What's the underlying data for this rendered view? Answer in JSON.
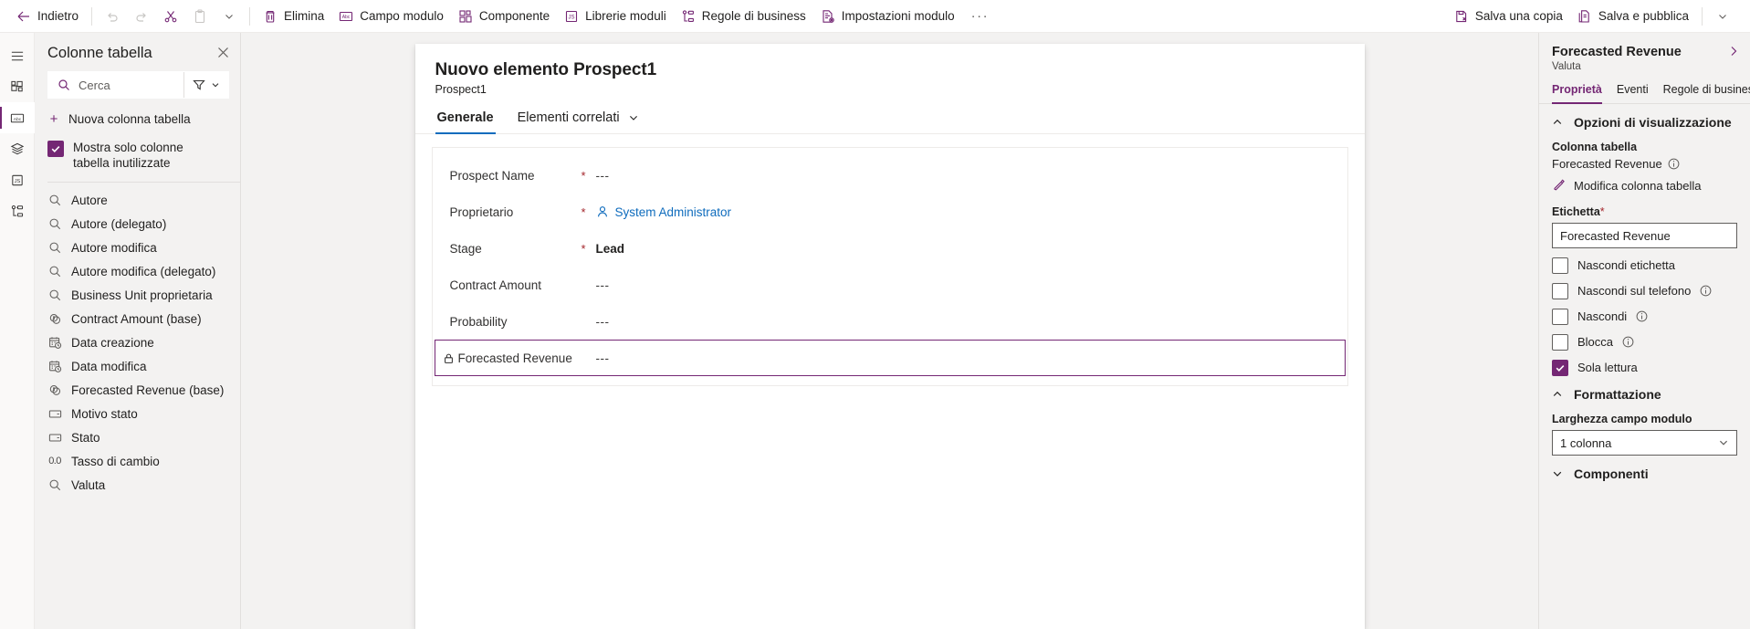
{
  "commandbar": {
    "back_label": "Indietro",
    "undo_label": "Annulla",
    "redo_label": "Ripeti",
    "cut_label": "Taglia",
    "paste_label": "Incolla",
    "delete_label": "Elimina",
    "form_field_label": "Campo modulo",
    "component_label": "Componente",
    "module_libraries_label": "Librerie moduli",
    "business_rules_label": "Regole di business",
    "form_settings_label": "Impostazioni modulo",
    "overflow_label": "···",
    "save_copy_label": "Salva una copia",
    "save_publish_label": "Salva e pubblica"
  },
  "rail": {
    "items": [
      {
        "name": "hamburger-menu",
        "label": "Menu"
      },
      {
        "name": "components",
        "label": "Componenti"
      },
      {
        "name": "table-columns",
        "label": "Colonne tabella"
      },
      {
        "name": "layers",
        "label": "Livelli"
      },
      {
        "name": "scripts",
        "label": "Librerie"
      },
      {
        "name": "business-rules",
        "label": "Regole di business"
      }
    ]
  },
  "columns_panel": {
    "title": "Colonne tabella",
    "search_placeholder": "Cerca",
    "filter_label": "Filtro",
    "new_column_label": "Nuova colonna tabella",
    "show_unused_label": "Mostra solo colonne tabella inutilizzate",
    "show_unused_checked": true,
    "items": [
      {
        "label": "Autore",
        "icon": "lookup-icon"
      },
      {
        "label": "Autore (delegato)",
        "icon": "lookup-icon"
      },
      {
        "label": "Autore modifica",
        "icon": "lookup-icon"
      },
      {
        "label": "Autore modifica (delegato)",
        "icon": "lookup-icon"
      },
      {
        "label": "Business Unit proprietaria",
        "icon": "lookup-icon"
      },
      {
        "label": "Contract Amount (base)",
        "icon": "currency-icon"
      },
      {
        "label": "Data creazione",
        "icon": "datetime-icon"
      },
      {
        "label": "Data modifica",
        "icon": "datetime-icon"
      },
      {
        "label": "Forecasted Revenue (base)",
        "icon": "currency-icon"
      },
      {
        "label": "Motivo stato",
        "icon": "choice-icon"
      },
      {
        "label": "Stato",
        "icon": "choice-icon"
      },
      {
        "label": "Tasso di cambio",
        "icon": "decimal-icon"
      },
      {
        "label": "Valuta",
        "icon": "lookup-icon"
      }
    ]
  },
  "form": {
    "title": "Nuovo elemento Prospect1",
    "subtitle": "Prospect1",
    "tabs": [
      {
        "label": "Generale",
        "active": true,
        "has_caret": false
      },
      {
        "label": "Elementi correlati",
        "active": false,
        "has_caret": true
      }
    ],
    "fields": [
      {
        "label": "Prospect Name",
        "required": true,
        "value": "---",
        "style": "dashes",
        "locked": false,
        "selected": false
      },
      {
        "label": "Proprietario",
        "required": true,
        "value": "System Administrator",
        "style": "link",
        "locked": false,
        "selected": false
      },
      {
        "label": "Stage",
        "required": true,
        "value": "Lead",
        "style": "bold",
        "locked": false,
        "selected": false
      },
      {
        "label": "Contract Amount",
        "required": false,
        "value": "---",
        "style": "dashes",
        "locked": false,
        "selected": false
      },
      {
        "label": "Probability",
        "required": false,
        "value": "---",
        "style": "dashes",
        "locked": false,
        "selected": false
      },
      {
        "label": "Forecasted Revenue",
        "required": false,
        "value": "---",
        "style": "dashes",
        "locked": true,
        "selected": true
      }
    ]
  },
  "properties": {
    "title": "Forecasted Revenue",
    "subtitle": "Valuta",
    "tabs": [
      {
        "label": "Proprietà",
        "active": true
      },
      {
        "label": "Eventi",
        "active": false
      },
      {
        "label": "Regole di business",
        "active": false
      }
    ],
    "display_options": {
      "heading": "Opzioni di visualizzazione",
      "expanded": true,
      "table_column_label": "Colonna tabella",
      "table_column_value": "Forecasted Revenue",
      "edit_column_link": "Modifica colonna tabella",
      "label_field_label": "Etichetta",
      "label_field_required": "*",
      "label_field_value": "Forecasted Revenue",
      "checkboxes": [
        {
          "label": "Nascondi etichetta",
          "checked": false,
          "info": false
        },
        {
          "label": "Nascondi sul telefono",
          "checked": false,
          "info": true
        },
        {
          "label": "Nascondi",
          "checked": false,
          "info": true
        },
        {
          "label": "Blocca",
          "checked": false,
          "info": true
        },
        {
          "label": "Sola lettura",
          "checked": true,
          "info": false
        }
      ]
    },
    "formatting": {
      "heading": "Formattazione",
      "expanded": true,
      "width_label": "Larghezza campo modulo",
      "width_value": "1 colonna"
    },
    "components": {
      "heading": "Componenti",
      "expanded": false
    }
  },
  "colors": {
    "accent": "#742774",
    "tab_accent": "#0f6cbd",
    "required": "#a4262c",
    "panel_bg": "#f3f2f1"
  }
}
